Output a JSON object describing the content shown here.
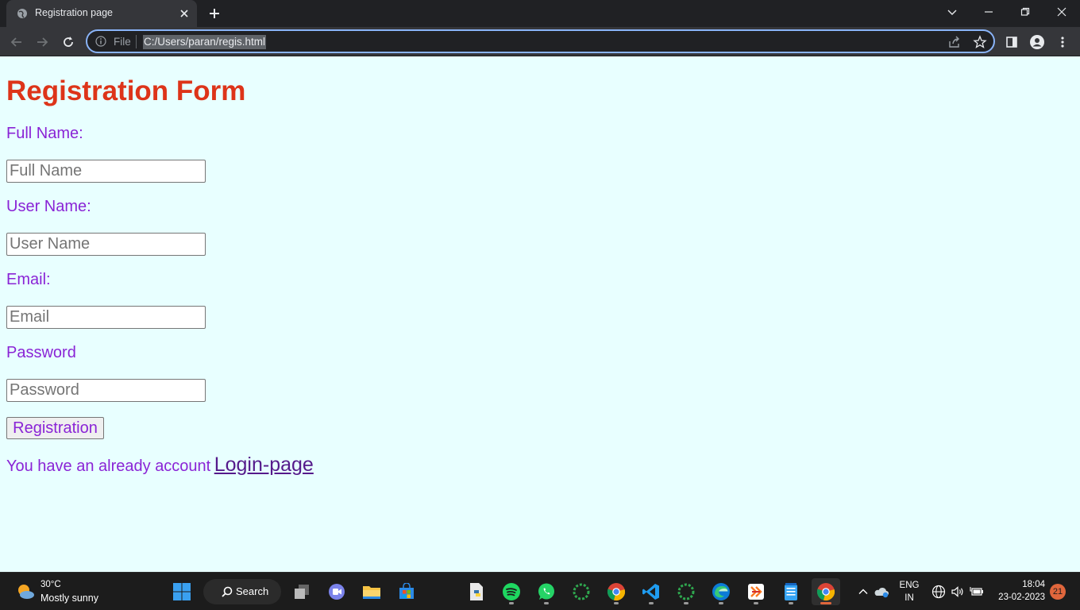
{
  "browser": {
    "tab_title": "Registration page",
    "omnibox": {
      "scheme_label": "File",
      "url": "C:/Users/paran/regis.html"
    }
  },
  "page": {
    "heading": "Registration Form",
    "fields": [
      {
        "label": "Full Name:",
        "placeholder": "Full Name"
      },
      {
        "label": "User Name:",
        "placeholder": "User Name"
      },
      {
        "label": "Email:",
        "placeholder": "Email"
      },
      {
        "label": "Password",
        "placeholder": "Password"
      }
    ],
    "submit_label": "Registration",
    "footer_text": "You have an already account",
    "login_link": "Login-page",
    "colors": {
      "heading": "#dd3419",
      "label": "#8a24d6",
      "background": "#e8ffff",
      "link": "#551a8b"
    }
  },
  "taskbar": {
    "weather": {
      "temp": "30°C",
      "desc": "Mostly sunny"
    },
    "search_label": "Search",
    "apps": [
      "start",
      "search",
      "task-view",
      "teams",
      "file-explorer",
      "store",
      "python",
      "spotify",
      "whatsapp",
      "app-green-1",
      "chrome",
      "vscode",
      "app-green-2",
      "edge",
      "xampp",
      "notepad",
      "chrome-active"
    ],
    "tray": {
      "lang_line1": "ENG",
      "lang_line2": "IN",
      "time": "18:04",
      "date": "23-02-2023",
      "notifications": "21"
    }
  }
}
